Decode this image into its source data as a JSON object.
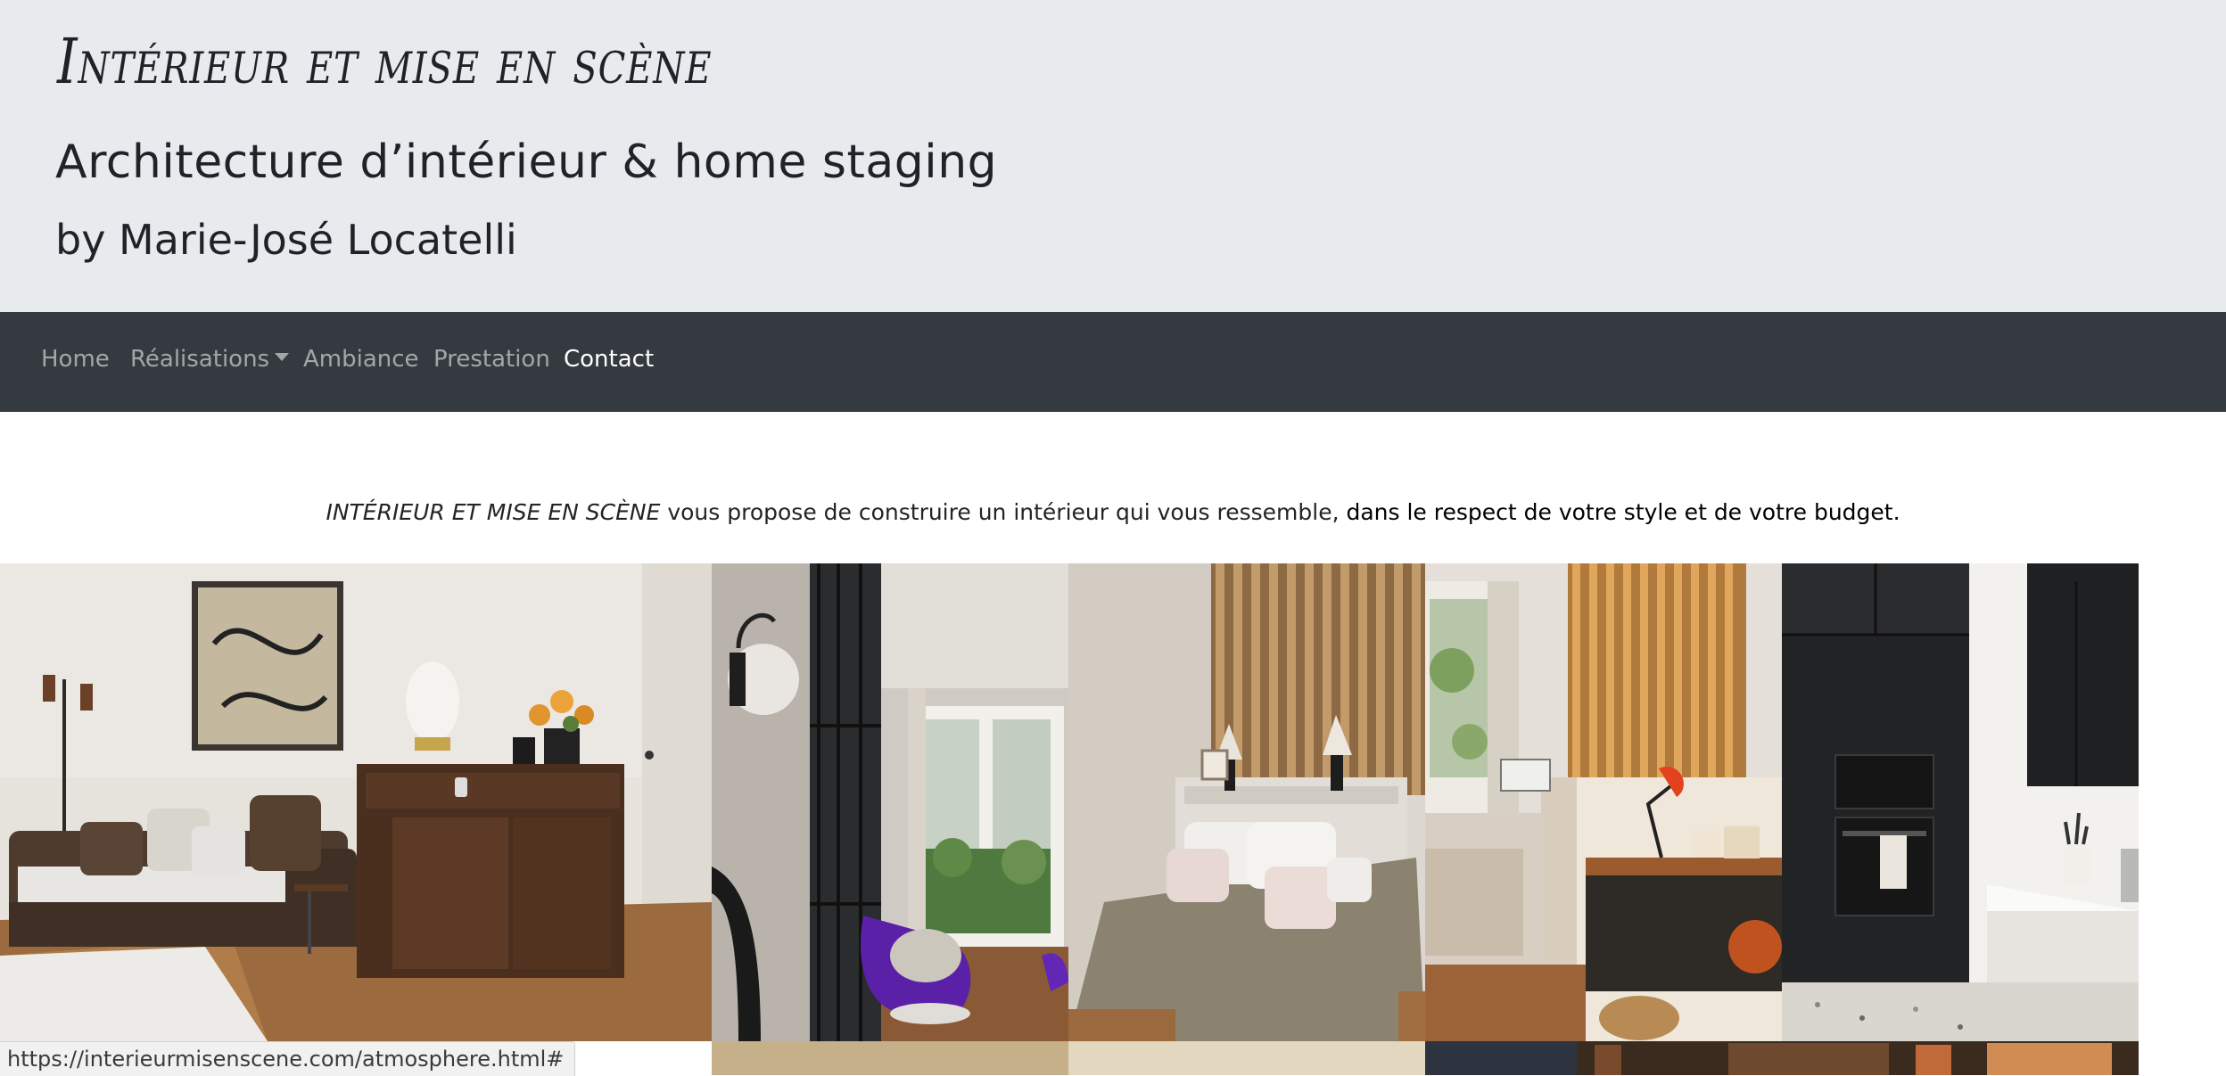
{
  "header": {
    "title": "Intérieur et mise en scène",
    "subtitle": "Architecture d’intérieur & home staging",
    "author": "by Marie-José Locatelli"
  },
  "nav": {
    "items": [
      {
        "label": "Home"
      },
      {
        "label": "Réalisations"
      },
      {
        "label": "Ambiance"
      },
      {
        "label": "Prestation"
      },
      {
        "label": "Contact"
      }
    ],
    "active": "Contact"
  },
  "intro": {
    "brand": "INTÉRIEUR ET MISE EN SCÈNE",
    "text": " vous propose de construire un intérieur qui vous ressemble, ",
    "emphasis": "dans le respect de votre style et de votre budget."
  },
  "gallery": {
    "photos": [
      {
        "subject": "living-room-sofa-sideboard"
      },
      {
        "subject": "glass-partition-purple-chair"
      },
      {
        "subject": "bedroom-wood-slat-headboard"
      },
      {
        "subject": "bedroom-desk-red-lamp"
      },
      {
        "subject": "black-kitchen-ovens"
      }
    ]
  },
  "status_bar": {
    "url": "https://interieurmisenscene.com/atmosphere.html#"
  }
}
